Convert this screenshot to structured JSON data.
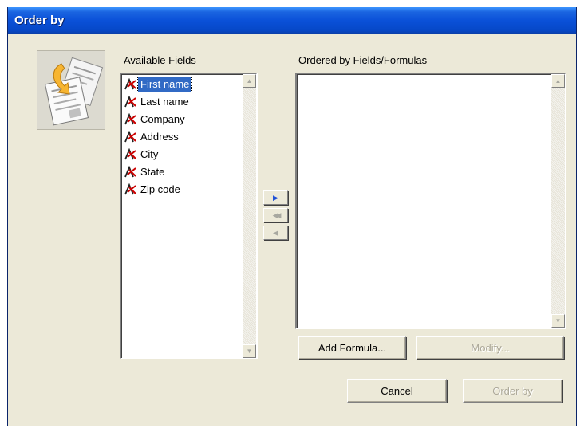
{
  "window": {
    "title": "Order by"
  },
  "available": {
    "label": "Available Fields",
    "fields": [
      {
        "name": "First name",
        "selected": true
      },
      {
        "name": "Last name",
        "selected": false
      },
      {
        "name": "Company",
        "selected": false
      },
      {
        "name": "Address",
        "selected": false
      },
      {
        "name": "City",
        "selected": false
      },
      {
        "name": "State",
        "selected": false
      },
      {
        "name": "Zip code",
        "selected": false
      }
    ],
    "field_icon": "field-a-icon"
  },
  "ordered": {
    "label": "Ordered by Fields/Formulas",
    "items": []
  },
  "transfer": {
    "add_icon": "arrow-right-icon",
    "remove_all_icon": "double-arrow-left-icon",
    "remove_icon": "arrow-left-icon"
  },
  "buttons": {
    "add_formula": "Add Formula...",
    "modify": "Modify...",
    "cancel": "Cancel",
    "order_by": "Order by"
  },
  "colors": {
    "titlebar": "#0a50d8",
    "dialog_bg": "#ece9d8",
    "selection": "#316ac5",
    "field_icon_red": "#cc0000"
  }
}
